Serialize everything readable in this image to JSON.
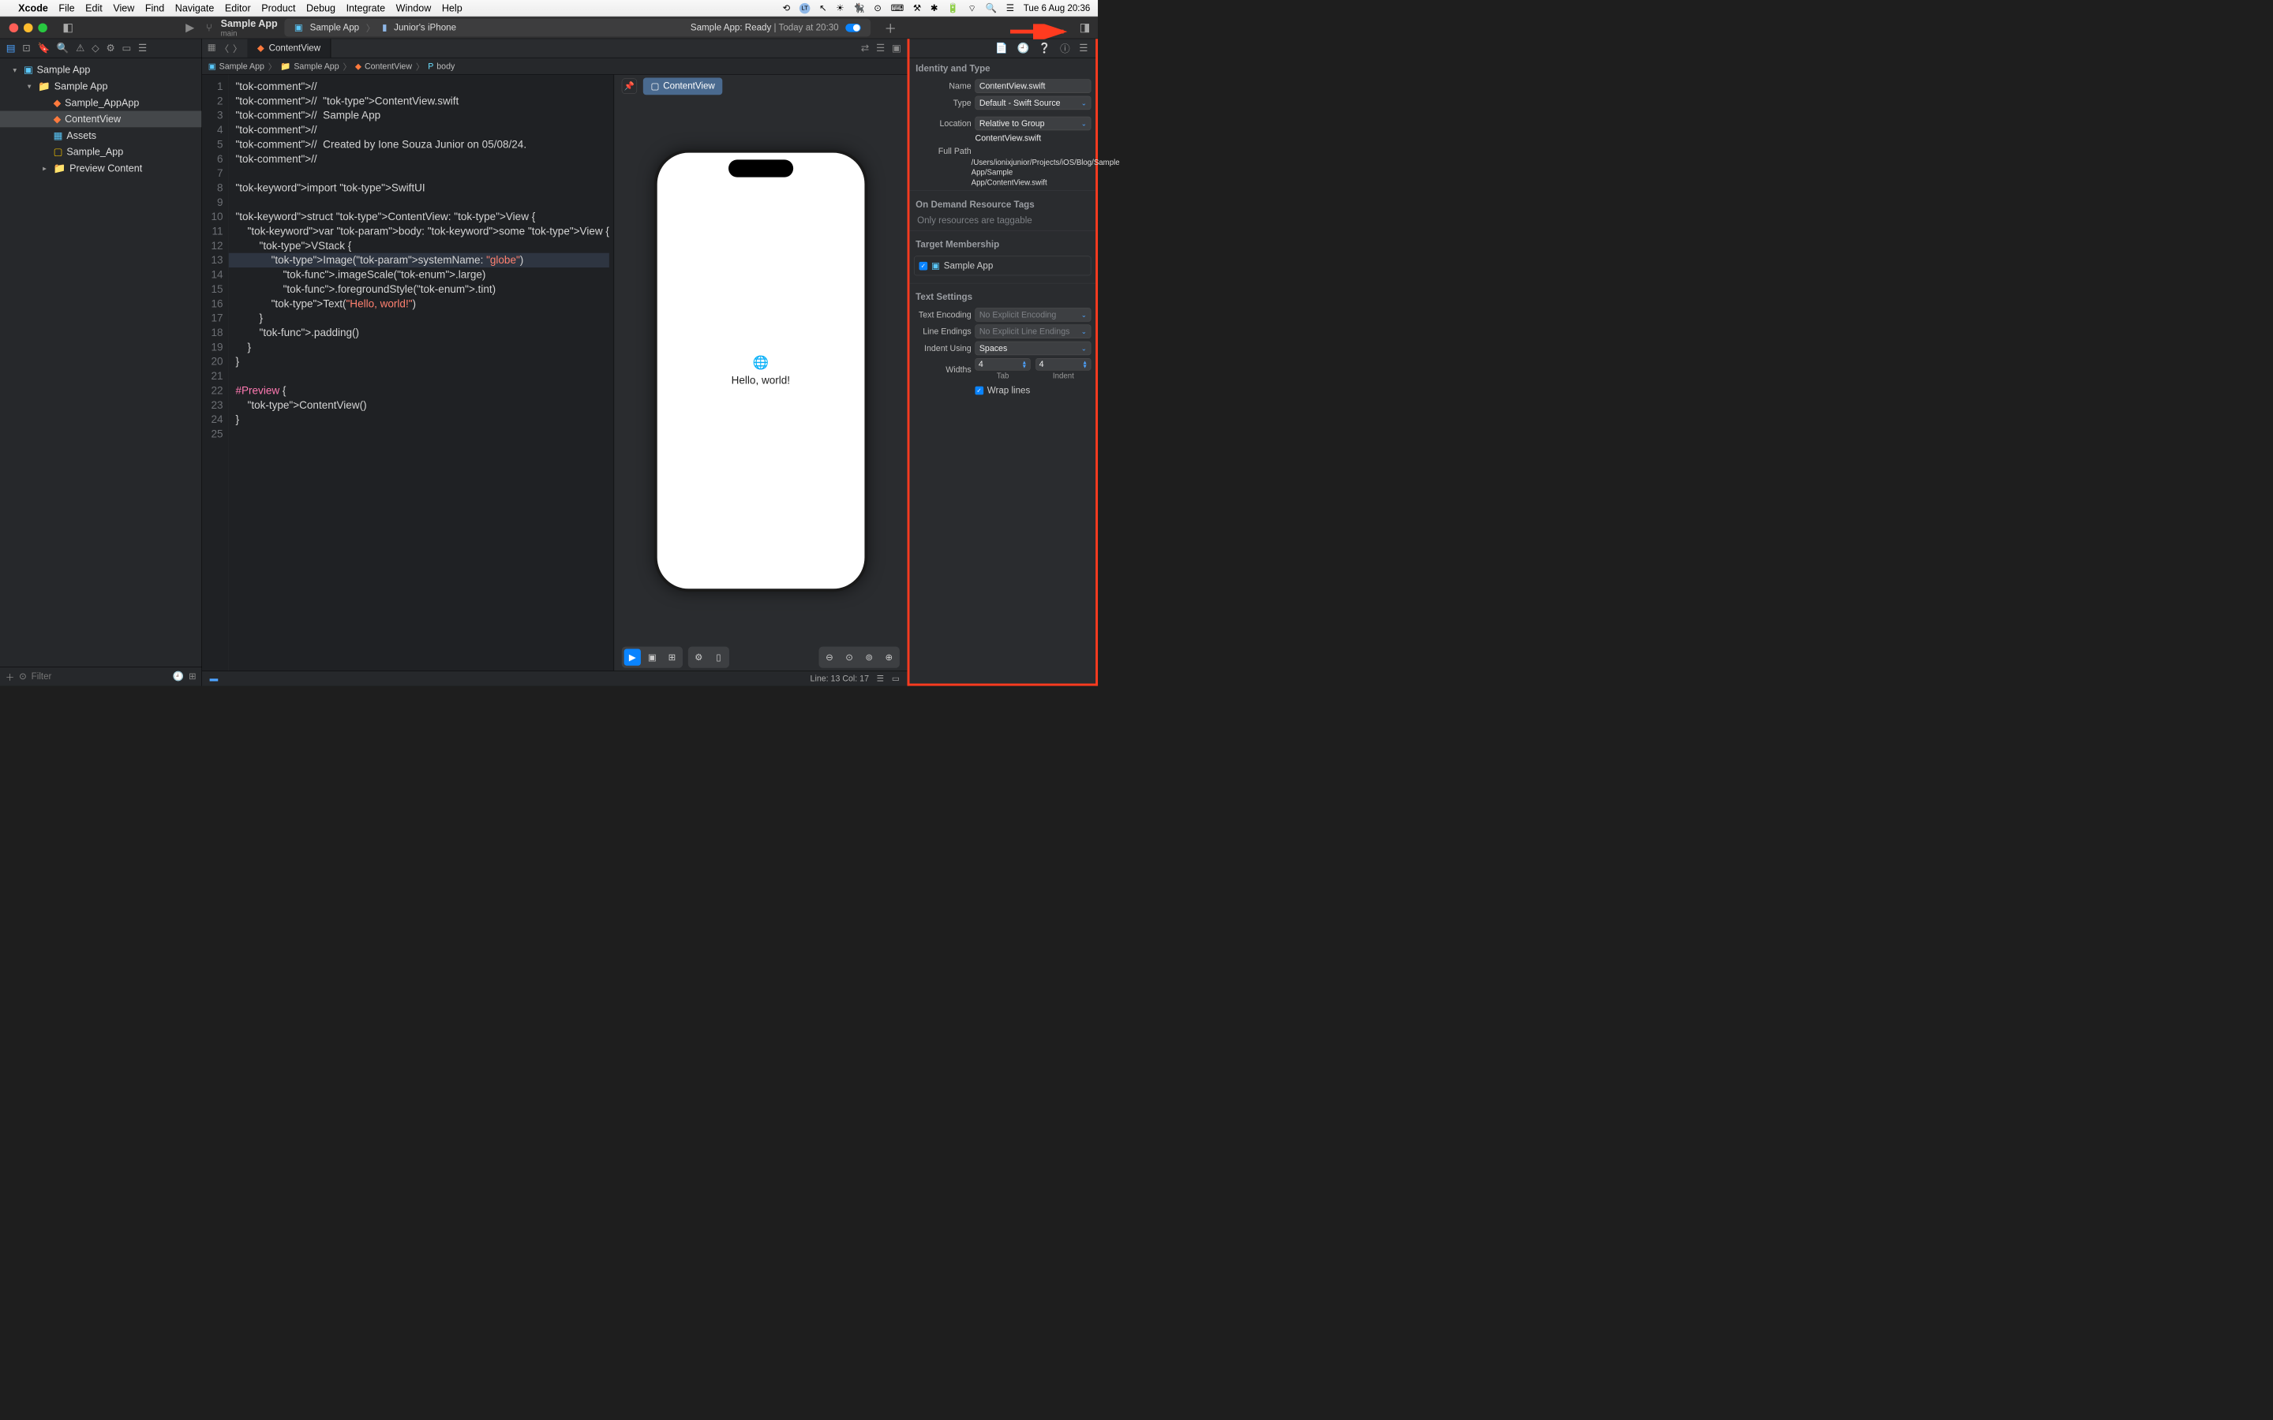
{
  "menubar": {
    "app": "Xcode",
    "items": [
      "File",
      "Edit",
      "View",
      "Find",
      "Navigate",
      "Editor",
      "Product",
      "Debug",
      "Integrate",
      "Window",
      "Help"
    ],
    "clock": "Tue 6 Aug  20:36"
  },
  "toolbar": {
    "scheme_title": "Sample App",
    "scheme_branch": "main",
    "device_app": "Sample App",
    "device_name": "Junior's iPhone",
    "status_prefix": "Sample App: ",
    "status_ready": "Ready",
    "status_time": " | Today at 20:30"
  },
  "navigator": {
    "root": "Sample App",
    "group": "Sample App",
    "files": [
      "Sample_AppApp",
      "ContentView",
      "Assets",
      "Sample_App",
      "Preview Content"
    ],
    "filter_placeholder": "Filter"
  },
  "tabs": {
    "open_file": "ContentView"
  },
  "jumpbar": {
    "items": [
      "Sample App",
      "Sample App",
      "ContentView",
      "body"
    ]
  },
  "code": {
    "lines": [
      "//",
      "//  ContentView.swift",
      "//  Sample App",
      "//",
      "//  Created by Ione Souza Junior on 05/08/24.",
      "//",
      "",
      "import SwiftUI",
      "",
      "struct ContentView: View {",
      "    var body: some View {",
      "        VStack {",
      "            Image(systemName: \"globe\")",
      "                .imageScale(.large)",
      "                .foregroundStyle(.tint)",
      "            Text(\"Hello, world!\")",
      "        }",
      "        .padding()",
      "    }",
      "}",
      "",
      "#Preview {",
      "    ContentView()",
      "}",
      ""
    ],
    "highlighted_line": 13
  },
  "preview": {
    "chip": "ContentView",
    "hello": "Hello, world!"
  },
  "statusbar": {
    "line_col": "Line: 13  Col: 17"
  },
  "inspector": {
    "identity_title": "Identity and Type",
    "name_label": "Name",
    "name_value": "ContentView.swift",
    "type_label": "Type",
    "type_value": "Default - Swift Source",
    "location_label": "Location",
    "location_value": "Relative to Group",
    "location_path": "ContentView.swift",
    "fullpath_label": "Full Path",
    "fullpath_value": "/Users/ionixjunior/Projects/iOS/Blog/Sample App/Sample App/ContentView.swift",
    "odr_title": "On Demand Resource Tags",
    "odr_placeholder": "Only resources are taggable",
    "target_title": "Target Membership",
    "target_name": "Sample App",
    "text_title": "Text Settings",
    "encoding_label": "Text Encoding",
    "encoding_value": "No Explicit Encoding",
    "lineend_label": "Line Endings",
    "lineend_value": "No Explicit Line Endings",
    "indent_label": "Indent Using",
    "indent_value": "Spaces",
    "widths_label": "Widths",
    "tab_value": "4",
    "indent_value_num": "4",
    "tab_sub": "Tab",
    "indent_sub": "Indent",
    "wrap_label": "Wrap lines"
  }
}
